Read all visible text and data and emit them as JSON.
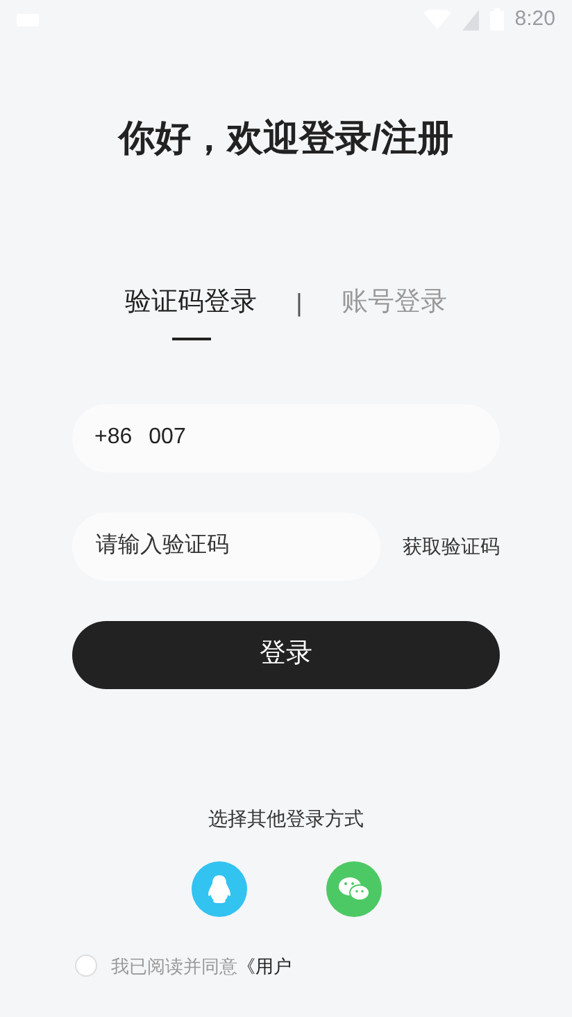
{
  "status_bar": {
    "time": "8:20"
  },
  "title": "你好，欢迎登录/注册",
  "tabs": [
    {
      "label": "验证码登录",
      "selected": true
    },
    {
      "label": "账号登录",
      "selected": false
    }
  ],
  "tab_separator": "|",
  "phone_field": {
    "country_code": "+86",
    "value": "007"
  },
  "code_field": {
    "placeholder": "请输入验证码"
  },
  "get_code_button": "获取验证码",
  "login_button": "登录",
  "other_methods": {
    "label": "选择其他登录方式",
    "options": [
      {
        "kind": "qq"
      },
      {
        "kind": "wechat"
      }
    ]
  },
  "agreement": {
    "checked": false,
    "text": "我已阅读并同意",
    "link": "《用户"
  }
}
